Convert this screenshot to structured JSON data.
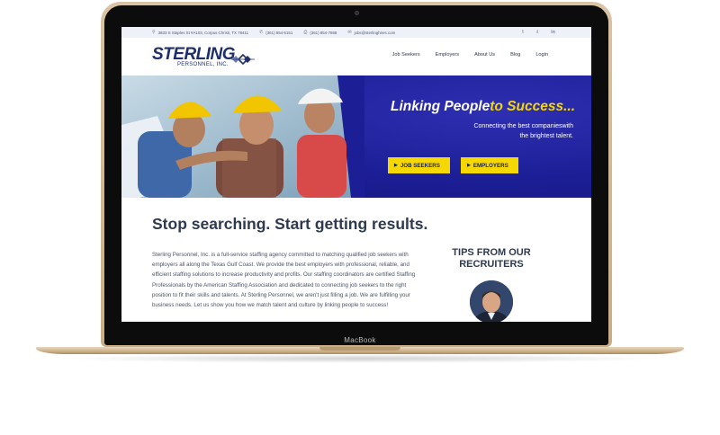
{
  "device": {
    "brand_label": "MacBook"
  },
  "topbar": {
    "address": "3833 S Staples St #A103, Corpus Christi, TX 78411",
    "phone1": "(361) 854-5151",
    "phone2": "(361) 854-7868",
    "email": "jobs@sterlinghires.com",
    "social": [
      "twitter",
      "facebook",
      "linkedin"
    ]
  },
  "logo": {
    "name": "STERLING",
    "sub": "PERSONNEL, INC."
  },
  "nav": {
    "job_seekers": "Job Seekers",
    "employers": "Employers",
    "about": "About Us",
    "blog": "Blog",
    "login": "Login"
  },
  "hero": {
    "title_main": "Linking People",
    "title_accent": "to Success...",
    "sub_line1": "Connecting the best companieswith",
    "sub_line2": "the brightest talent.",
    "btn_seekers": "JOB SEEKERS",
    "btn_employers": "EMPLOYERS"
  },
  "main": {
    "headline": "Stop searching. Start getting results.",
    "body": "Sterling Personnel, Inc. is a full-service staffing agency committed to matching qualified job seekers with employers all along the Texas Gulf Coast.  We provide the best employers with professional, reliable, and efficient staffing solutions to increase productivity and profits. Our staffing coordinators are certified Staffing Professionals by the American Staffing Association and dedicated to connecting job seekers to the right position to fit their skills and talents. At Sterling Personnel, we aren't just filling a job. We are fulfilling your business needs. Let us show you how we match talent and culture by linking people to success!",
    "tips_title": "TIPS FROM OUR RECRUITERS"
  },
  "colors": {
    "navy": "#1f2f6b",
    "hero_blue": "#1c1e96",
    "yellow": "#f5d800",
    "text": "#2f3a4f"
  }
}
